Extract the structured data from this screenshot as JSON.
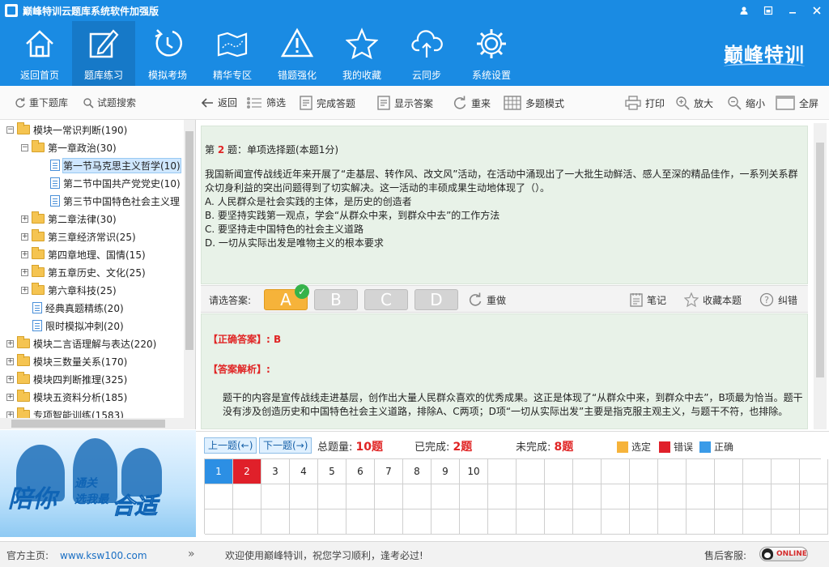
{
  "window": {
    "title": "巅峰特训云题库系统软件加强版",
    "controls": [
      "user-icon",
      "restore-icon",
      "minimize-icon",
      "close-icon"
    ]
  },
  "nav": {
    "items": [
      {
        "label": "返回首页",
        "icon": "home-icon"
      },
      {
        "label": "题库练习",
        "icon": "edit-icon",
        "active": true
      },
      {
        "label": "模拟考场",
        "icon": "clock-icon"
      },
      {
        "label": "精华专区",
        "icon": "map-icon"
      },
      {
        "label": "错题强化",
        "icon": "warning-icon"
      },
      {
        "label": "我的收藏",
        "icon": "star-icon"
      },
      {
        "label": "云同步",
        "icon": "cloud-icon"
      },
      {
        "label": "系统设置",
        "icon": "gear-icon"
      }
    ],
    "brand": "巅峰特训"
  },
  "left_toolbar": {
    "reload": "重下题库",
    "search": "试题搜索"
  },
  "tree": [
    {
      "label": "模块一常识判断(190)",
      "level": 0,
      "type": "folder",
      "expanded": true
    },
    {
      "label": "第一章政治(30)",
      "level": 1,
      "type": "folder",
      "expanded": true
    },
    {
      "label": "第一节马克思主义哲学(10)",
      "level": 2,
      "type": "doc",
      "selected": true
    },
    {
      "label": "第二节中国共产党党史(10)",
      "level": 2,
      "type": "doc"
    },
    {
      "label": "第三节中国特色社会主义理",
      "level": 2,
      "type": "doc"
    },
    {
      "label": "第二章法律(30)",
      "level": 1,
      "type": "folder"
    },
    {
      "label": "第三章经济常识(25)",
      "level": 1,
      "type": "folder"
    },
    {
      "label": "第四章地理、国情(15)",
      "level": 1,
      "type": "folder"
    },
    {
      "label": "第五章历史、文化(25)",
      "level": 1,
      "type": "folder"
    },
    {
      "label": "第六章科技(25)",
      "level": 1,
      "type": "folder"
    },
    {
      "label": "经典真题精练(20)",
      "level": 1,
      "type": "doc"
    },
    {
      "label": "限时模拟冲刺(20)",
      "level": 1,
      "type": "doc"
    },
    {
      "label": "模块二言语理解与表达(220)",
      "level": 0,
      "type": "folder"
    },
    {
      "label": "模块三数量关系(170)",
      "level": 0,
      "type": "folder"
    },
    {
      "label": "模块四判断推理(325)",
      "level": 0,
      "type": "folder"
    },
    {
      "label": "模块五资料分析(185)",
      "level": 0,
      "type": "folder"
    },
    {
      "label": "专项智能训练(1583)",
      "level": 0,
      "type": "folder"
    }
  ],
  "banner": {
    "line1": "陪你",
    "line2a": "通关",
    "line2b": "选我最",
    "line3": "合适"
  },
  "right_toolbar": {
    "back": "返回",
    "filter": "筛选",
    "finish": "完成答题",
    "show_answer": "显示答案",
    "redo": "重来",
    "multi_mode": "多题模式",
    "print": "打印",
    "zoom_in": "放大",
    "zoom_out": "缩小",
    "fullscreen": "全屏"
  },
  "question": {
    "prefix": "第",
    "number": "2",
    "suffix": "题：单项选择题(本题1分)",
    "stem": "我国新闻宣传战线近年来开展了“走基层、转作风、改文风”活动，在活动中涌现出了一大批生动鲜活、感人至深的精品佳作，一系列关系群众切身利益的突出问题得到了切实解决。这一活动的丰硕成果生动地体现了（）。",
    "options": [
      "A. 人民群众是社会实践的主体，是历史的创造者",
      "B. 要坚持实践第一观点，学会“从群众中来，到群众中去”的工作方法",
      "C. 要坚持走中国特色的社会主义道路",
      "D. 一切从实际出发是唯物主义的根本要求"
    ]
  },
  "answer_bar": {
    "label": "请选答案:",
    "choices": [
      "A",
      "B",
      "C",
      "D"
    ],
    "selected": "A",
    "redo": "重做",
    "notes": "笔记",
    "favorite": "收藏本题",
    "report": "纠错"
  },
  "explanation": {
    "correct": "【正确答案】: B",
    "analysis_title": "【答案解析】:",
    "text": "题干的内容是宣传战线走进基层，创作出大量人民群众喜欢的优秀成果。这正是体现了“从群众中来，到群众中去”，B项最为恰当。题干没有涉及创造历史和中国特色社会主义道路，排除A、C两项；D项“一切从实际出发”主要是指克服主观主义，与题干不符，也排除。"
  },
  "pager": {
    "prev": "上一题(←)",
    "next": "下一题(→)",
    "total_label": "总题量:",
    "total": "10题",
    "done_label": "已完成:",
    "done": "2题",
    "todo_label": "未完成:",
    "todo": "8题",
    "legend": [
      {
        "label": "选定",
        "color": "#f6b33a"
      },
      {
        "label": "错误",
        "color": "#e0202a"
      },
      {
        "label": "正确",
        "color": "#3a9be8"
      }
    ],
    "cells": [
      "1",
      "2",
      "3",
      "4",
      "5",
      "6",
      "7",
      "8",
      "9",
      "10"
    ],
    "current": "1",
    "wrong": [
      "2"
    ]
  },
  "statusbar": {
    "home_label": "官方主页:",
    "home_url": "www.ksw100.com",
    "arrow": "»",
    "welcome": "欢迎使用巅峰特训，祝您学习顺利，逢考必过!",
    "service_label": "售后客服:",
    "online": "ONLINE"
  },
  "colors": {
    "header_blue": "#1a8be3",
    "content_green": "#e8f2e8",
    "accent_red": "#e02424",
    "selected_orange": "#f6b33a"
  }
}
